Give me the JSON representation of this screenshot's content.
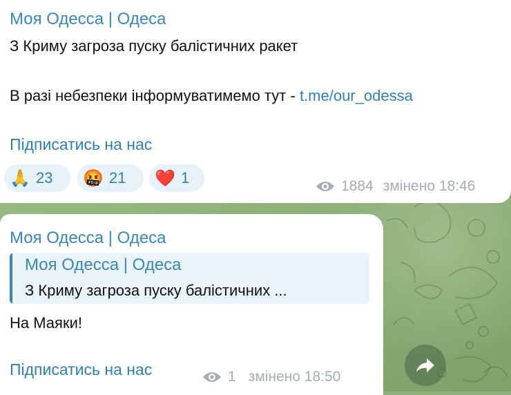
{
  "colors": {
    "accent": "#3a86b8",
    "link": "#2f7fb5",
    "reaction_bg": "#e6f1f8",
    "meta": "#a3adb5",
    "wallpaper": "#93b57c"
  },
  "message1": {
    "sender": "Моя Одесса | Одеса",
    "line1": "З Криму загроза пуску балістичних ракет",
    "line2_prefix": "В разі небезпеки інформуватимемо тут - ",
    "line2_link": "t.me/our_odessa",
    "subscribe": "Підписатись на нас",
    "reactions": [
      {
        "emoji": "🙏",
        "icon": "praying-hands-icon",
        "count": "23"
      },
      {
        "emoji": "🤬",
        "icon": "cursing-face-icon",
        "count": "21"
      },
      {
        "emoji": "❤️",
        "icon": "red-heart-icon",
        "count": "1"
      }
    ],
    "views": "1884",
    "edited": "змінено 18:46"
  },
  "message2": {
    "sender": "Моя Одесса | Одеса",
    "quote": {
      "sender": "Моя Одесса | Одеса",
      "text": "З Криму загроза пуску балістичних ..."
    },
    "text": "На Маяки!",
    "subscribe": "Підписатись на нас",
    "views": "1",
    "edited": "змінено 18:50"
  },
  "icons": {
    "views": "eye-icon",
    "share": "share-arrow-icon"
  }
}
